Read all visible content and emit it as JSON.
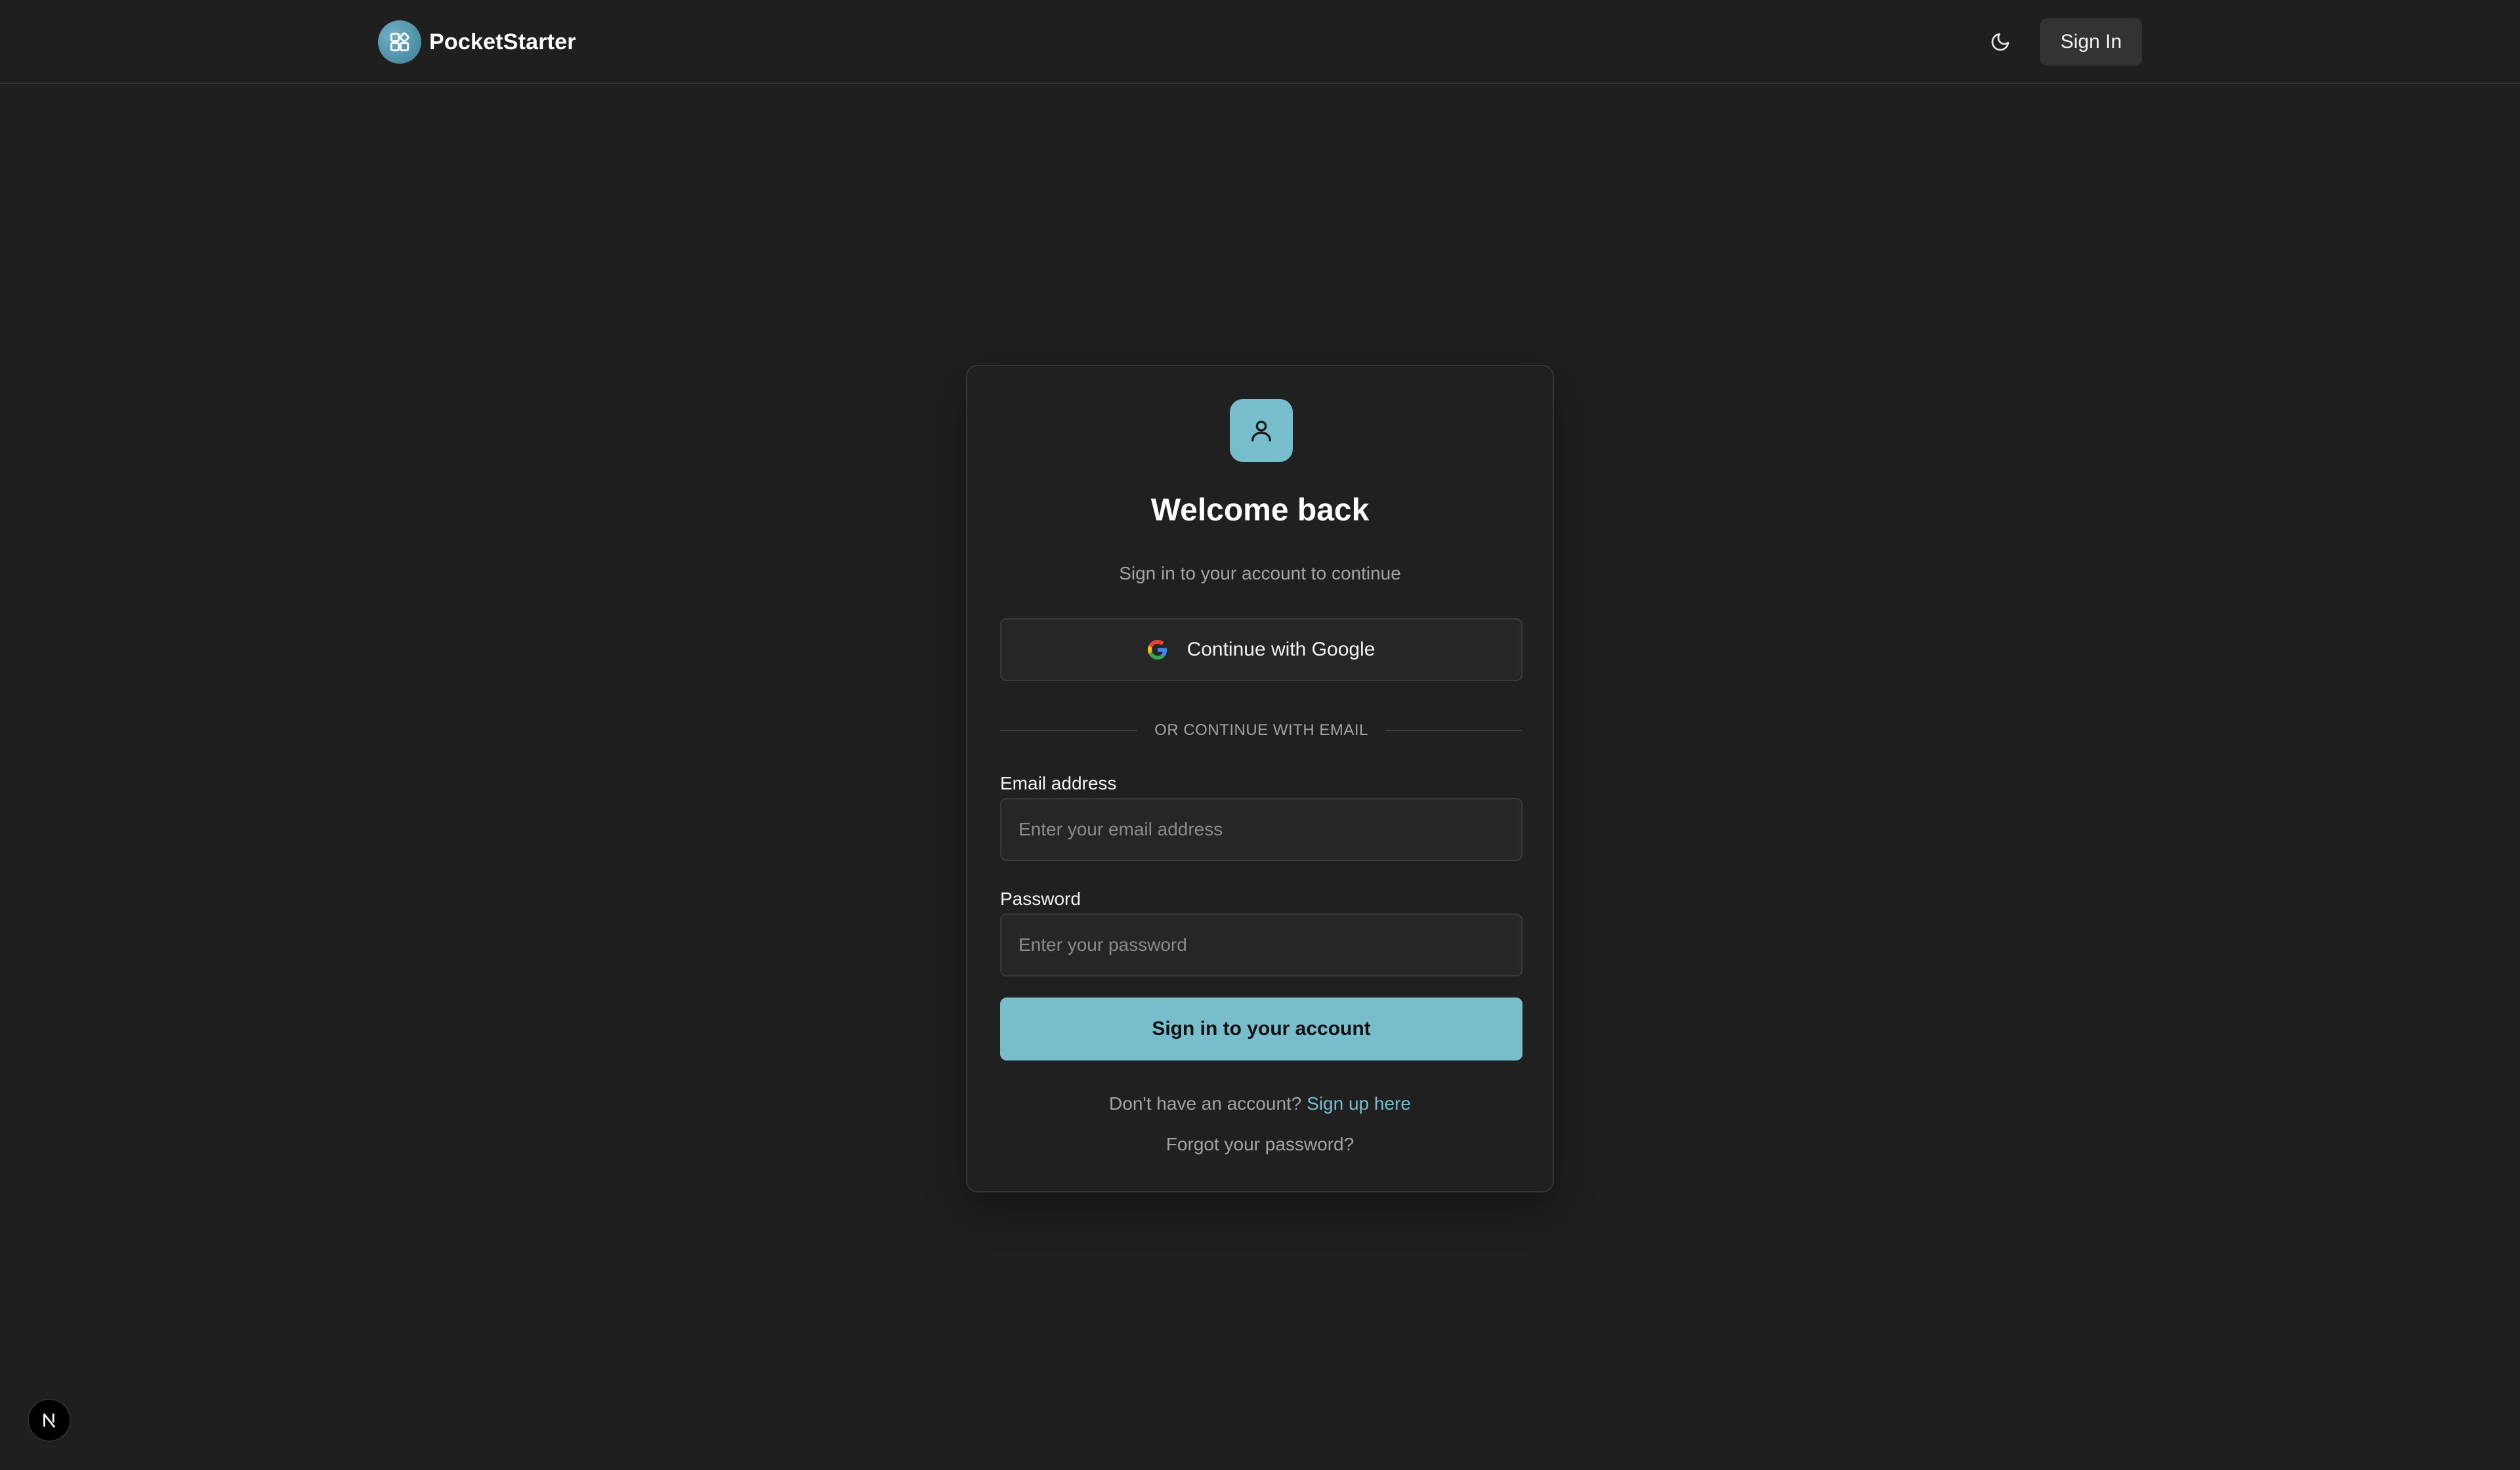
{
  "header": {
    "brand_name": "PocketStarter",
    "logo_icon": "app-grid-icon",
    "theme_toggle_icon": "moon-icon",
    "signin_label": "Sign In"
  },
  "card": {
    "avatar_icon": "user-icon",
    "title": "Welcome back",
    "subtitle": "Sign in to your account to continue",
    "google_button_label": "Continue with Google",
    "divider_text": "OR CONTINUE WITH EMAIL",
    "email": {
      "label": "Email address",
      "placeholder": "Enter your email address",
      "value": ""
    },
    "password": {
      "label": "Password",
      "placeholder": "Enter your password",
      "value": ""
    },
    "submit_label": "Sign in to your account",
    "signup_prompt": "Don't have an account?",
    "signup_link": "Sign up here",
    "forgot_label": "Forgot your password?"
  },
  "dev_badge": {
    "letter": "N"
  },
  "colors": {
    "background": "#1f1f1f",
    "accent": "#78bdcc",
    "card_border": "#343434",
    "muted_text": "#a3a3a3"
  }
}
